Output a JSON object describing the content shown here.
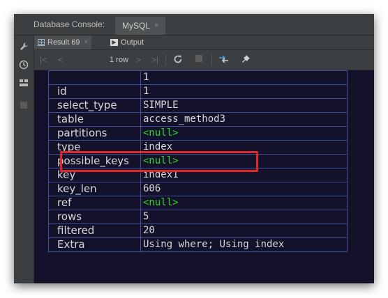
{
  "window": {
    "console_label": "Database Console:",
    "active_tab": "MySQL",
    "tab_close": "×"
  },
  "left_strip": {
    "icons": [
      "wrench-icon",
      "clock-icon",
      "layout-icon",
      "stop-icon"
    ]
  },
  "subtabs": [
    {
      "label": "Result 69",
      "icon": "grid-icon",
      "active": true,
      "close": "×"
    },
    {
      "label": "Output",
      "icon": "output-icon",
      "active": false
    }
  ],
  "toolbar": {
    "rows_label": "1 row",
    "first": "|<",
    "prev": "<",
    "next": ">",
    "last": ">|",
    "refresh_icon": "refresh-icon",
    "stop_icon": "stop-icon",
    "compare_icon": "compare-icon",
    "pin_icon": "pin-icon"
  },
  "table": {
    "header": {
      "name": "",
      "value": "1"
    },
    "rows": [
      {
        "name": "id",
        "value": "1",
        "is_null": false
      },
      {
        "name": "select_type",
        "value": "SIMPLE",
        "is_null": false
      },
      {
        "name": "table",
        "value": "access_method3",
        "is_null": false
      },
      {
        "name": "partitions",
        "value": "<null>",
        "is_null": true
      },
      {
        "name": "type",
        "value": "index",
        "is_null": false
      },
      {
        "name": "possible_keys",
        "value": "<null>",
        "is_null": true
      },
      {
        "name": "key",
        "value": "index1",
        "is_null": false
      },
      {
        "name": "key_len",
        "value": "606",
        "is_null": false
      },
      {
        "name": "ref",
        "value": "<null>",
        "is_null": true
      },
      {
        "name": "rows",
        "value": "5",
        "is_null": false
      },
      {
        "name": "filtered",
        "value": "20",
        "is_null": false
      },
      {
        "name": "Extra",
        "value": "Using where; Using index",
        "is_null": false
      }
    ]
  },
  "colors": {
    "null_value": "#2bd62b",
    "grid_line": "#3f4f9a",
    "highlight": "#e02828",
    "background": "#13122a"
  }
}
